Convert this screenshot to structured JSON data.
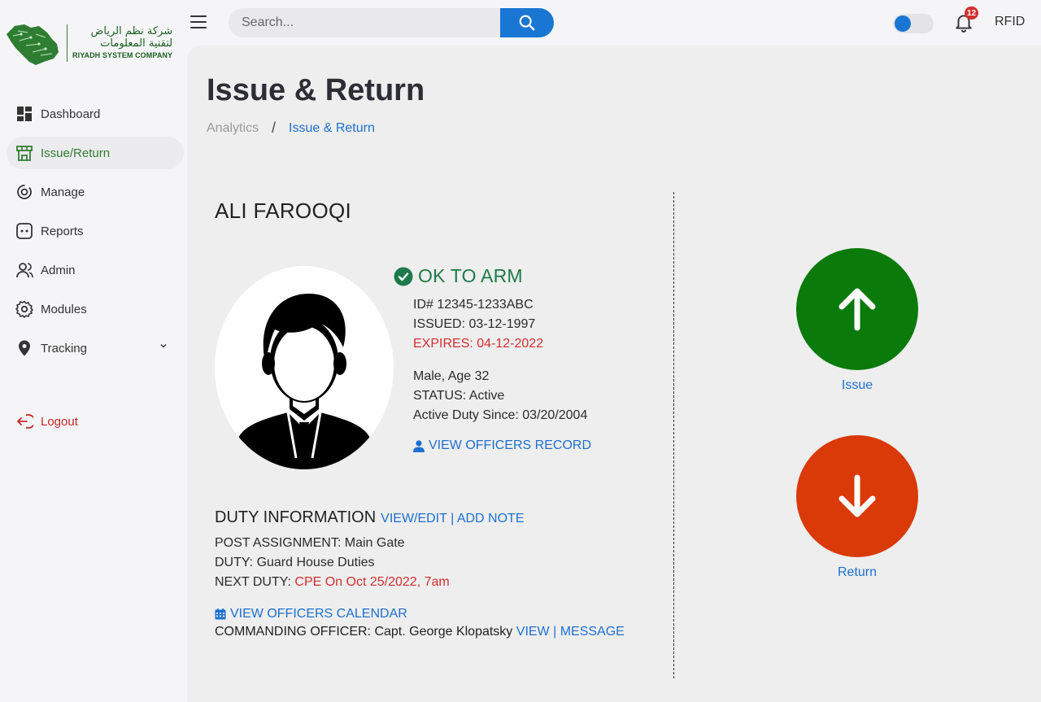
{
  "company": {
    "name_ar_line1": "شركة نظم الرياض",
    "name_ar_line2": "لتقنية المعلومات",
    "name_en": "RIYADH SYSTEM COMPANY"
  },
  "search": {
    "placeholder": "Search..."
  },
  "header": {
    "notification_count": "12",
    "rfid_label": "RFID"
  },
  "sidebar": {
    "items": [
      {
        "label": "Dashboard",
        "icon": "dashboard-icon"
      },
      {
        "label": "Issue/Return",
        "icon": "store-icon",
        "active": true
      },
      {
        "label": "Manage",
        "icon": "manage-icon"
      },
      {
        "label": "Reports",
        "icon": "reports-icon"
      },
      {
        "label": "Admin",
        "icon": "admin-icon"
      },
      {
        "label": "Modules",
        "icon": "gear-icon"
      },
      {
        "label": "Tracking",
        "icon": "location-pin-icon"
      }
    ],
    "logout_label": "Logout"
  },
  "page": {
    "title": "Issue & Return",
    "breadcrumb": {
      "parent": "Analytics",
      "separator": "/",
      "current": "Issue & Return"
    }
  },
  "officer": {
    "name": "ALI FAROOQI",
    "status": "OK TO ARM",
    "id_line": "ID# 12345-1233ABC",
    "issued_line": "ISSUED: 03-12-1997",
    "expires_line": "EXPIRES: 04-12-2022",
    "demographics": "Male, Age 32",
    "status_line": "STATUS: Active",
    "active_duty_line": "Active Duty Since: 03/20/2004",
    "view_record_label": "VIEW OFFICERS RECORD"
  },
  "duty": {
    "heading": "DUTY INFORMATION",
    "edit_links": "VIEW/EDIT | ADD NOTE",
    "post_assignment": "POST ASSIGNMENT: Main Gate",
    "duty_line": "DUTY: Guard House Duties",
    "next_duty_label": "NEXT DUTY: ",
    "next_duty_value": "CPE On Oct 25/2022, 7am",
    "calendar_label": "VIEW OFFICERS CALENDAR",
    "commanding_officer": "COMMANDING OFFICER: Capt. George Klopatsky",
    "commanding_links": "VIEW | MESSAGE"
  },
  "actions": {
    "issue_label": "Issue",
    "return_label": "Return"
  },
  "colors": {
    "primary": "#1976d2",
    "link": "#1e6fcf",
    "issue_green": "#0a7a0a",
    "return_red": "#d93a08",
    "warning_red": "#d32f2f",
    "ok_green": "#1e7a4a",
    "active_nav": "#2e7d32"
  }
}
